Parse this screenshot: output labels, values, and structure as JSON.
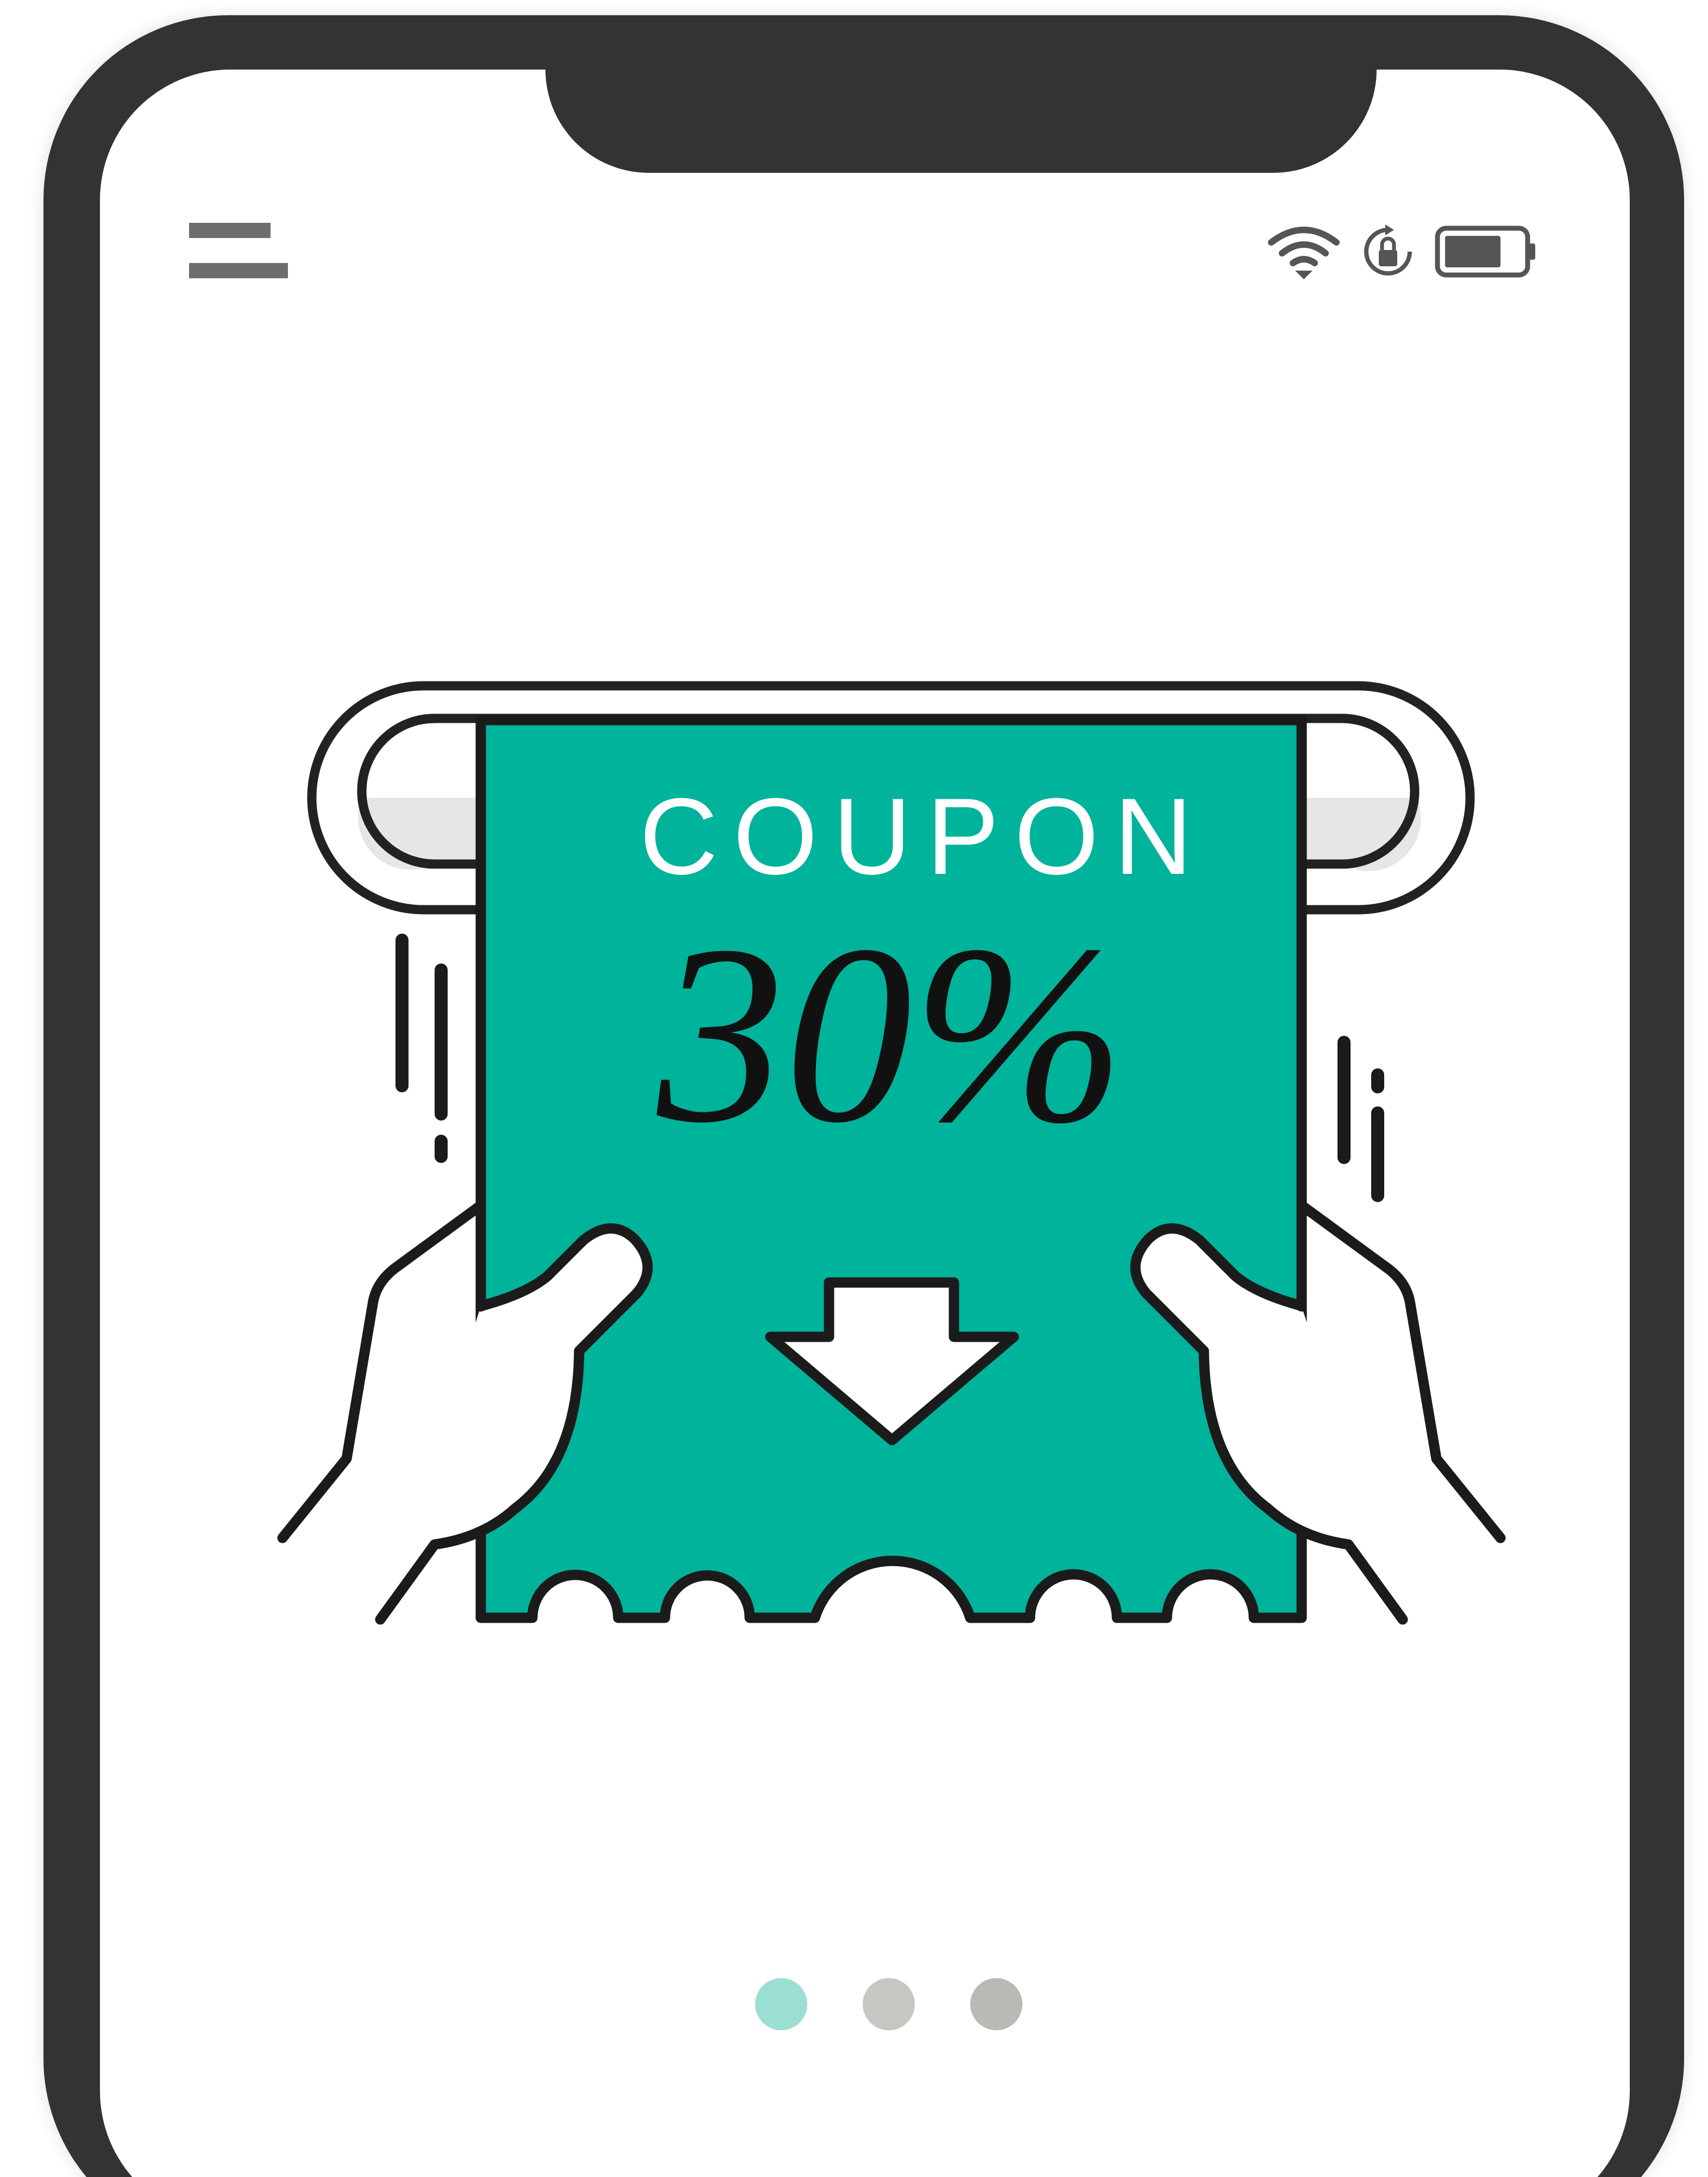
{
  "app": {
    "colors": {
      "frame": "#333333",
      "screen": "#ffffff",
      "accent": "#00b39b",
      "menu": "#6e6e6e",
      "status_icons": "#555555"
    }
  },
  "header": {
    "menu_icon": "hamburger-menu-icon",
    "status_icons": [
      "wifi-icon",
      "rotation-lock-icon",
      "battery-icon"
    ]
  },
  "coupon": {
    "label": "COUPON",
    "value": "30%",
    "arrow_icon": "arrow-down-icon"
  },
  "pager": {
    "total": 3,
    "active_index": 0,
    "dots": [
      {
        "state": "active",
        "color": "#9bdfd2"
      },
      {
        "state": "inactive",
        "color": "#c6c6c2"
      },
      {
        "state": "inactive",
        "color": "#b9b9b5"
      }
    ]
  }
}
